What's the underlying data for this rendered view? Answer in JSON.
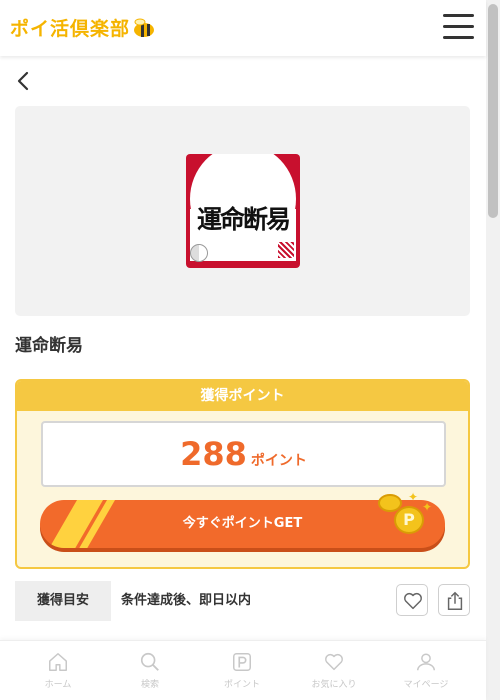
{
  "header": {
    "logo_text": "ポイ活倶楽部"
  },
  "app": {
    "icon_text": "運命断易",
    "title": "運命断易"
  },
  "points": {
    "header_label": "獲得ポイント",
    "value": "288",
    "unit": "ポイント",
    "get_button_label": "今すぐポイントGET",
    "coin_symbol": "P"
  },
  "criteria": {
    "label": "獲得目安",
    "text": "条件達成後、即日以内"
  },
  "tabs": [
    {
      "label": "ホーム"
    },
    {
      "label": "検索"
    },
    {
      "label": "ポイント"
    },
    {
      "label": "お気に入り"
    },
    {
      "label": "マイページ"
    }
  ],
  "colors": {
    "accent": "#f26a2b",
    "gold": "#f5c842",
    "logo": "#f5b400"
  }
}
